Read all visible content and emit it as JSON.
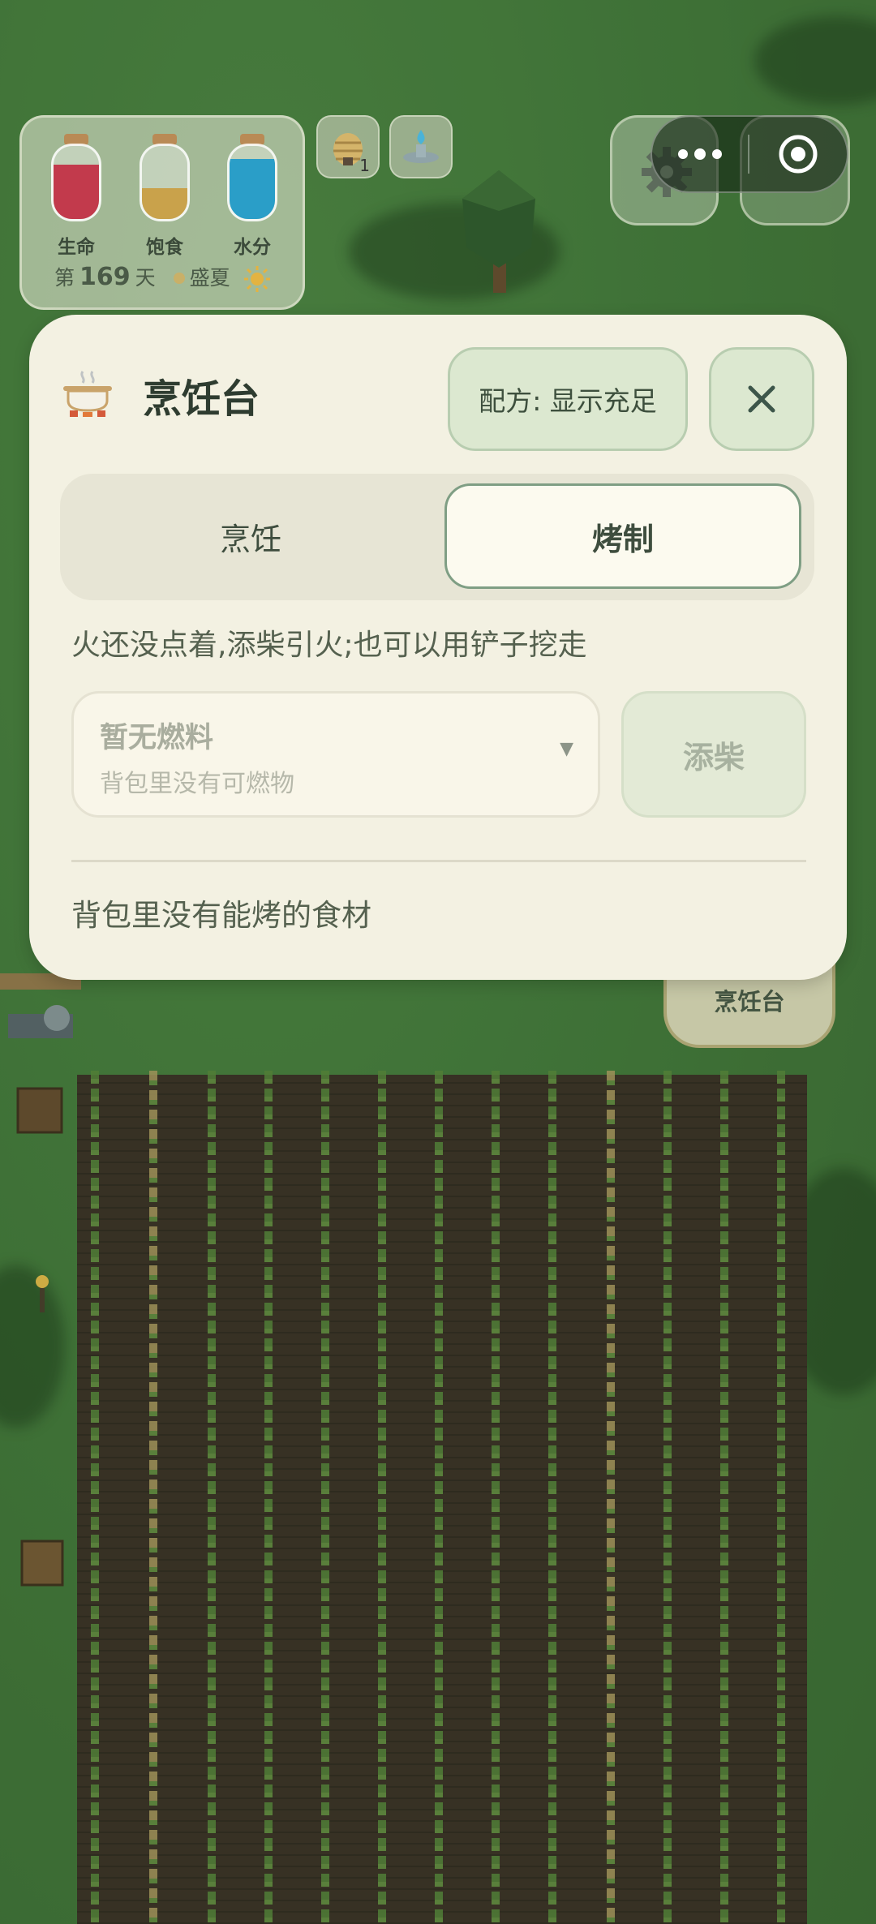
{
  "hud": {
    "stats": [
      {
        "label": "生命",
        "color": "#c23a4c",
        "level": 0.75
      },
      {
        "label": "饱食",
        "color": "#c9a24b",
        "level": 0.42
      },
      {
        "label": "水分",
        "color": "#2a9ec8",
        "level": 0.82
      }
    ],
    "day_prefix": "第",
    "day_number": "169",
    "day_suffix": "天",
    "season": "盛夏",
    "beehive_count": "1"
  },
  "panel": {
    "title": "烹饪台",
    "recipe_filter_label": "配方: 显示充足",
    "close_glyph": "✕",
    "tabs": [
      {
        "label": "烹饪",
        "active": false
      },
      {
        "label": "烤制",
        "active": true
      }
    ],
    "hint": "火还没点着,添柴引火;也可以用铲子挖走",
    "fuel_select": {
      "selected": "暂无燃料",
      "subtitle": "背包里没有可燃物",
      "caret": "▼"
    },
    "add_fuel_label": "添柴",
    "empty_message": "背包里没有能烤的食材"
  },
  "world": {
    "cooking_station_label": "烹饪台"
  },
  "colors": {
    "panel_bg": "#f3f1e2",
    "accent_green": "#7f9e84",
    "button_green": "#dce8d0"
  }
}
